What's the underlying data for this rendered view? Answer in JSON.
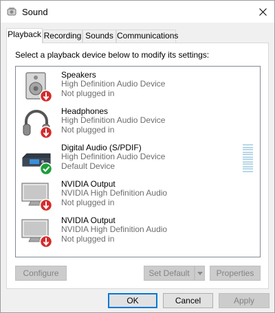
{
  "window": {
    "title": "Sound"
  },
  "tabs": [
    {
      "label": "Playback",
      "active": true
    },
    {
      "label": "Recording",
      "active": false
    },
    {
      "label": "Sounds",
      "active": false
    },
    {
      "label": "Communications",
      "active": false
    }
  ],
  "playback": {
    "instructions": "Select a playback device below to modify its settings:",
    "devices": [
      {
        "name": "Speakers",
        "description": "High Definition Audio Device",
        "status": "Not plugged in",
        "icon": "speaker-icon",
        "status_badge": "red-down-arrow"
      },
      {
        "name": "Headphones",
        "description": "High Definition Audio Device",
        "status": "Not plugged in",
        "icon": "headphones-icon",
        "status_badge": "red-down-arrow"
      },
      {
        "name": "Digital Audio (S/PDIF)",
        "description": "High Definition Audio Device",
        "status": "Default Device",
        "icon": "digital-audio-icon",
        "status_badge": "green-check"
      },
      {
        "name": "NVIDIA Output",
        "description": "NVIDIA High Definition Audio",
        "status": "Not plugged in",
        "icon": "monitor-icon",
        "status_badge": "red-down-arrow"
      },
      {
        "name": "NVIDIA Output",
        "description": "NVIDIA High Definition Audio",
        "status": "Not plugged in",
        "icon": "monitor-icon",
        "status_badge": "red-down-arrow"
      }
    ],
    "buttons": {
      "configure": "Configure",
      "set_default": "Set Default",
      "properties": "Properties"
    }
  },
  "footer": {
    "ok": "OK",
    "cancel": "Cancel",
    "apply": "Apply"
  },
  "colors": {
    "accent": "#0078d7",
    "status_red": "#d42b2b",
    "status_green": "#1e9e3a",
    "disabled_text": "#838383"
  }
}
